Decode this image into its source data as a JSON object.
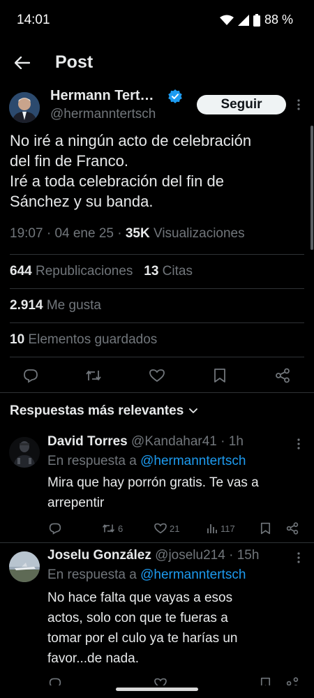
{
  "status_bar": {
    "time": "14:01",
    "battery": "88 %"
  },
  "header": {
    "title": "Post"
  },
  "tweet": {
    "author_name": "Hermann Tert…",
    "author_handle": "@hermanntertsch",
    "follow_label": "Seguir",
    "text_lines": [
      "No iré a ningún acto de celebración",
      "del fin de Franco.",
      "Iré a toda celebración del fin de",
      "Sánchez y su banda."
    ],
    "time": "19:07",
    "date": "04 ene 25",
    "views_count": "35K",
    "views_label": "Visualizaciones",
    "reposts_count": "644",
    "reposts_label": "Republicaciones",
    "quotes_count": "13",
    "quotes_label": "Citas",
    "likes_count": "2.914",
    "likes_label": "Me gusta",
    "bookmarks_count": "10",
    "bookmarks_label": "Elementos guardados"
  },
  "replies_header": "Respuestas más relevantes",
  "replies": [
    {
      "name": "David Torres",
      "handle": "@Kandahar41",
      "time": "1h",
      "reply_to_prefix": "En respuesta a",
      "reply_to_handle": "@hermanntertsch",
      "text_lines": [
        "Mira que hay porrón gratis. Te vas a",
        "arrepentir"
      ],
      "reposts": "6",
      "likes": "21",
      "views": "117"
    },
    {
      "name": "Joselu González",
      "handle": "@joselu214",
      "time": "15h",
      "reply_to_prefix": "En respuesta a",
      "reply_to_handle": "@hermanntertsch",
      "text_lines": [
        "No hace falta que vayas a esos",
        "actos, solo con que te fueras a",
        "tomar por el culo ya te harías un",
        "favor...de nada."
      ]
    }
  ],
  "colors": {
    "accent": "#1d9bf0",
    "muted": "#71767b",
    "text": "#e7e9ea",
    "divider": "#2f3336"
  }
}
